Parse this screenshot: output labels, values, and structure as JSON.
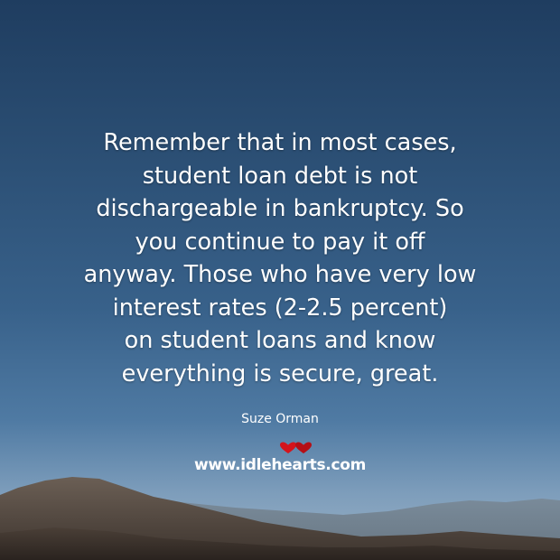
{
  "quote": {
    "lines": [
      "Remember that in most cases,",
      "student loan debt is not",
      "dischargeable in bankruptcy. So",
      "you continue to pay it off",
      "anyway. Those who have very low",
      "interest rates (2-2.5 percent)",
      "on student loans and know",
      "everything is secure, great."
    ]
  },
  "author": "Suze Orman",
  "watermark": {
    "text": "www.idlehearts.com",
    "icon": "hearts-icon",
    "icon_color": "#d4141c"
  },
  "colors": {
    "sky_top": "#1f3d60",
    "sky_bottom": "#9db3c6",
    "text": "#ffffff"
  }
}
